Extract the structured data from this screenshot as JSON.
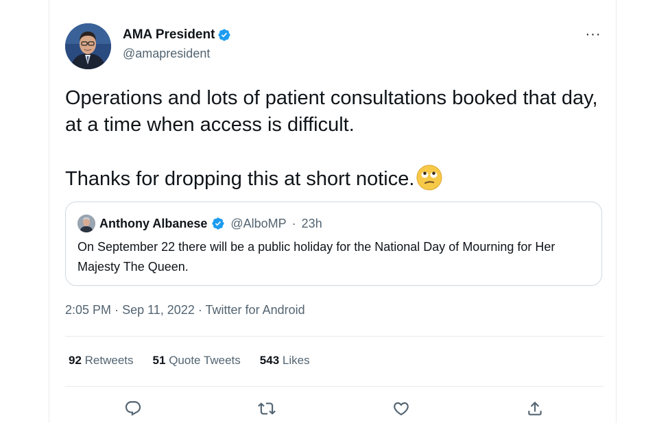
{
  "author": {
    "name": "AMA President",
    "handle": "@amapresident",
    "verified": true,
    "avatar": "avatar-portrait"
  },
  "icons": {
    "more": "more-horizontal-icon",
    "verified": "verified-badge-icon",
    "emoji": "face-with-rolling-eyes-emoji",
    "reply": "reply-icon",
    "retweet": "retweet-icon",
    "like": "like-icon",
    "share": "share-icon"
  },
  "more_label": "···",
  "tweet": {
    "line1": "Operations and lots of patient consultations booked that day, at a time when access is difficult.",
    "line2": "Thanks for dropping this at short notice."
  },
  "quote": {
    "name": "Anthony Albanese",
    "handle": "@AlboMP",
    "separator": "·",
    "time": "23h",
    "text": "On September 22 there will be a public holiday for the National Day of Mourning for Her Majesty The Queen."
  },
  "meta": {
    "time": "2:05 PM",
    "sep1": "·",
    "date": "Sep 11, 2022",
    "sep2": "·",
    "source": "Twitter for Android"
  },
  "stats": {
    "retweets_count": "92",
    "retweets_label": "Retweets",
    "quotes_count": "51",
    "quotes_label": "Quote Tweets",
    "likes_count": "543",
    "likes_label": "Likes"
  },
  "colors": {
    "verified": "#1d9bf0",
    "secondary_text": "#536471",
    "primary_text": "#0f1419",
    "border": "#cfd9de"
  }
}
